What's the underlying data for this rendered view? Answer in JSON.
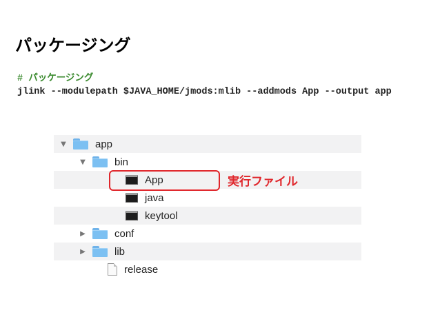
{
  "slide": {
    "title": "パッケージング",
    "code_comment": "# パッケージング",
    "code_command": "jlink --modulepath $JAVA_HOME/jmods:mlib --addmods App --output app"
  },
  "finder": {
    "items": [
      {
        "name": "app",
        "type": "folder",
        "disclosure": "▼"
      },
      {
        "name": "bin",
        "type": "folder",
        "disclosure": "▼"
      },
      {
        "name": "App",
        "type": "executable",
        "disclosure": ""
      },
      {
        "name": "java",
        "type": "executable",
        "disclosure": ""
      },
      {
        "name": "keytool",
        "type": "executable",
        "disclosure": ""
      },
      {
        "name": "conf",
        "type": "folder",
        "disclosure": "▶"
      },
      {
        "name": "lib",
        "type": "folder",
        "disclosure": "▶"
      },
      {
        "name": "release",
        "type": "document",
        "disclosure": ""
      }
    ]
  },
  "callout": {
    "label": "実行ファイル",
    "color": "#e0262b"
  },
  "colors": {
    "comment": "#3a8a2e",
    "folder": "#7cc0f2"
  }
}
